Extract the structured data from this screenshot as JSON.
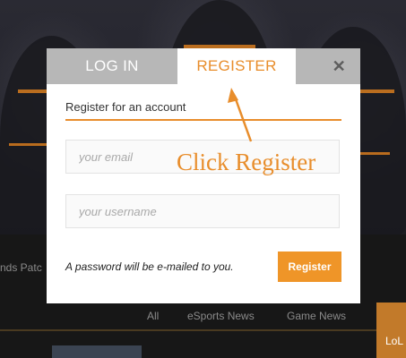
{
  "background": {
    "patch_text": "nds Patc",
    "nav": [
      "All",
      "eSports News",
      "Game News"
    ],
    "side_button": "LoL"
  },
  "modal": {
    "tabs": {
      "login": "LOG IN",
      "register": "REGISTER",
      "close": "✕"
    },
    "heading": "Register for an account",
    "email_placeholder": "your email",
    "username_placeholder": "your username",
    "note": "A password will be e-mailed to you.",
    "submit": "Register"
  },
  "annotation": {
    "text": "Click Register"
  },
  "colors": {
    "accent": "#e88d2b",
    "tab_inactive": "#b7b7b7",
    "button": "#ef9528"
  }
}
